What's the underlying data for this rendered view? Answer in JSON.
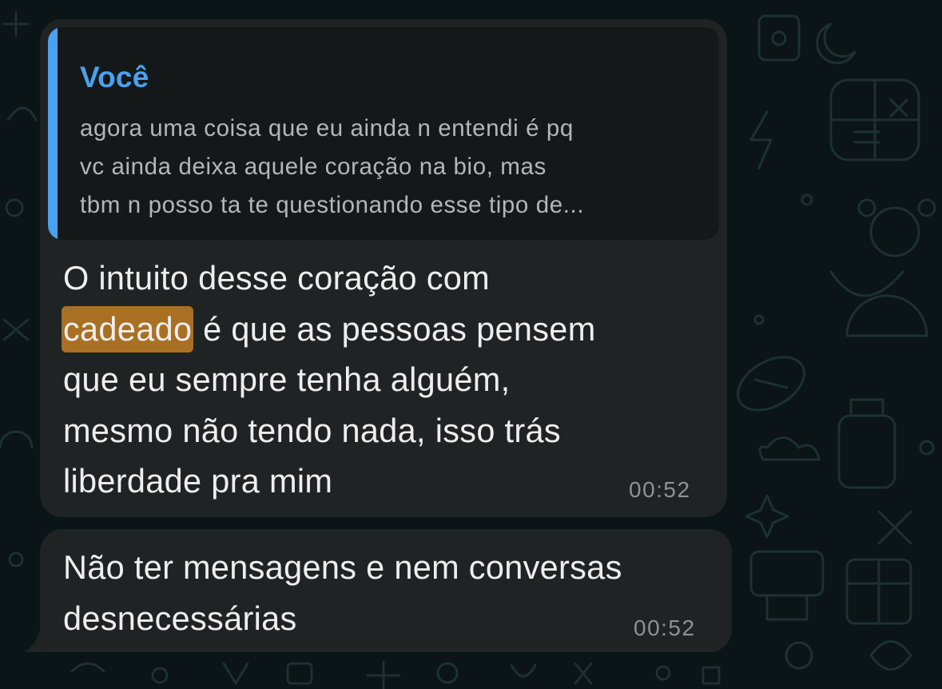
{
  "theme": {
    "background": "#0b1416",
    "bubble": "#1f2324",
    "quote_background": "#141819",
    "accent": "#4aa1ef",
    "highlight": "#a97024"
  },
  "messages": [
    {
      "reply_to": {
        "author": "Você",
        "lines": [
          "agora uma coisa que eu ainda n entendi é pq",
          "vc ainda deixa aquele coração na bio, mas",
          "tbm n posso ta te questionando esse tipo de..."
        ]
      },
      "lines": {
        "l1": "O intuito desse coração com",
        "l2_highlight": "cadeado",
        "l2_rest": " é que as pessoas pensem",
        "l3": "que eu sempre tenha alguém,",
        "l4": "mesmo não tendo nada, isso trás",
        "l5": "liberdade pra mim"
      },
      "time": "00:52"
    },
    {
      "lines": {
        "l1": "Não ter mensagens e nem conversas",
        "l2": "desnecessárias"
      },
      "time": "00:52"
    }
  ]
}
